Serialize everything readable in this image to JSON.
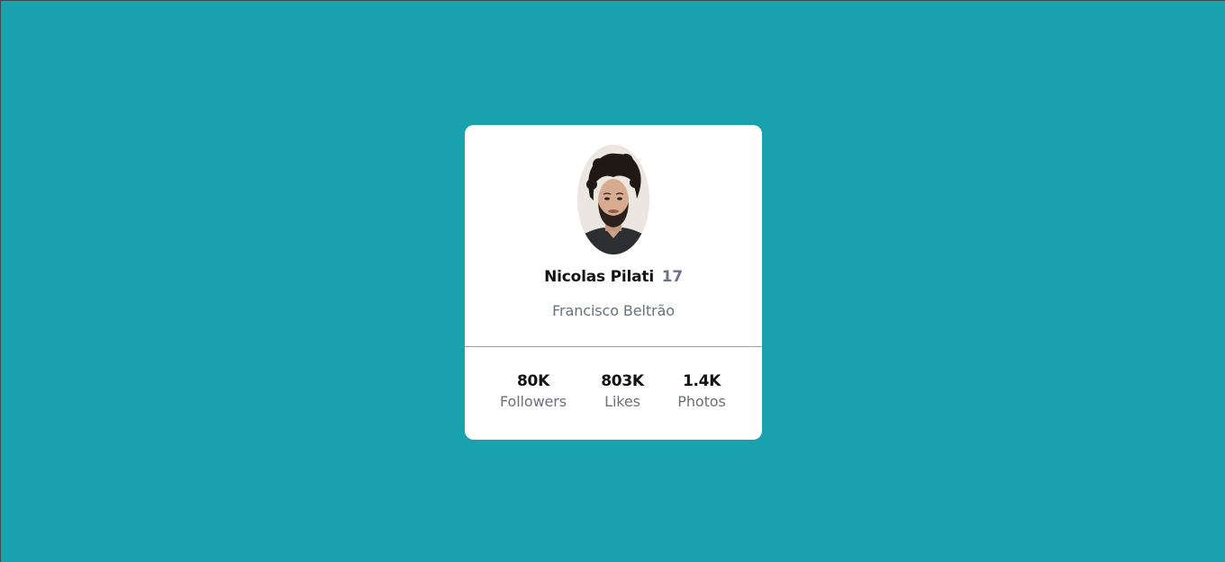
{
  "profile": {
    "name": "Nicolas Pilati",
    "age": "17",
    "location": "Francisco Beltrão",
    "avatar_alt": "profile photo"
  },
  "stats": {
    "followers": {
      "value": "80K",
      "label": "Followers"
    },
    "likes": {
      "value": "803K",
      "label": "Likes"
    },
    "photos": {
      "value": "1.4K",
      "label": "Photos"
    }
  },
  "colors": {
    "background": "#19a1ae",
    "card": "#ffffff",
    "primary_text": "#121212",
    "secondary_text": "#6b7079",
    "age_text": "#6e7287"
  }
}
